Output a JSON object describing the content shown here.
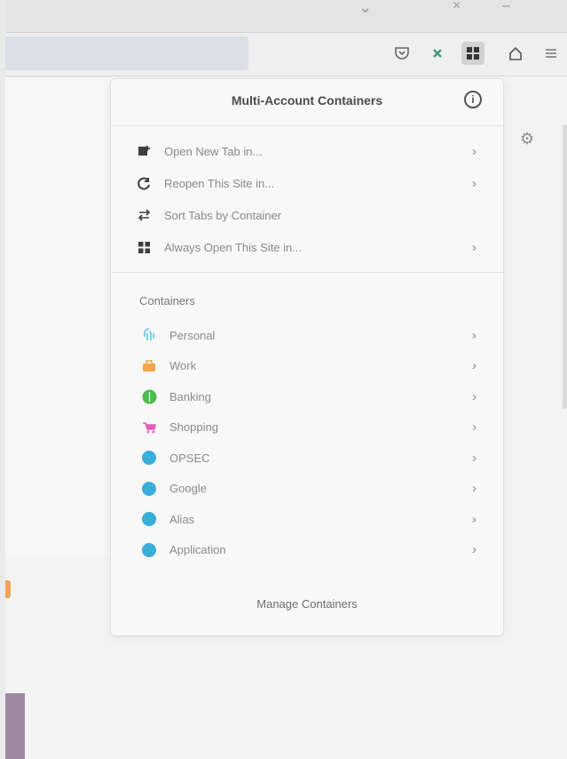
{
  "panel": {
    "title": "Multi-Account Containers",
    "menu": [
      {
        "label": "Open New Tab in...",
        "icon": "new-tab-icon",
        "has_chevron": true
      },
      {
        "label": "Reopen This Site in...",
        "icon": "reopen-icon",
        "has_chevron": true
      },
      {
        "label": "Sort Tabs by Container",
        "icon": "sort-icon",
        "has_chevron": false
      },
      {
        "label": "Always Open This Site in...",
        "icon": "grid-icon",
        "has_chevron": true
      }
    ],
    "containers_heading": "Containers",
    "containers": [
      {
        "name": "Personal",
        "icon": "fingerprint-icon",
        "color": "#62c4e8"
      },
      {
        "name": "Work",
        "icon": "briefcase-icon",
        "color": "#f3a64c"
      },
      {
        "name": "Banking",
        "icon": "dollar-icon",
        "color": "#4cbb47"
      },
      {
        "name": "Shopping",
        "icon": "cart-icon",
        "color": "#e55eb8"
      },
      {
        "name": "OPSEC",
        "icon": "circle-icon",
        "color": "#3aaedb"
      },
      {
        "name": "Google",
        "icon": "circle-icon",
        "color": "#3aaedb"
      },
      {
        "name": "Alias",
        "icon": "circle-icon",
        "color": "#3aaedb"
      },
      {
        "name": "Application",
        "icon": "circle-icon",
        "color": "#3aaedb"
      }
    ],
    "manage_label": "Manage Containers"
  },
  "toolbar": {
    "icons": [
      "pocket-icon",
      "extension-icon",
      "containers-icon",
      "home-icon",
      "menu-icon"
    ],
    "active_icon": "containers-icon"
  }
}
